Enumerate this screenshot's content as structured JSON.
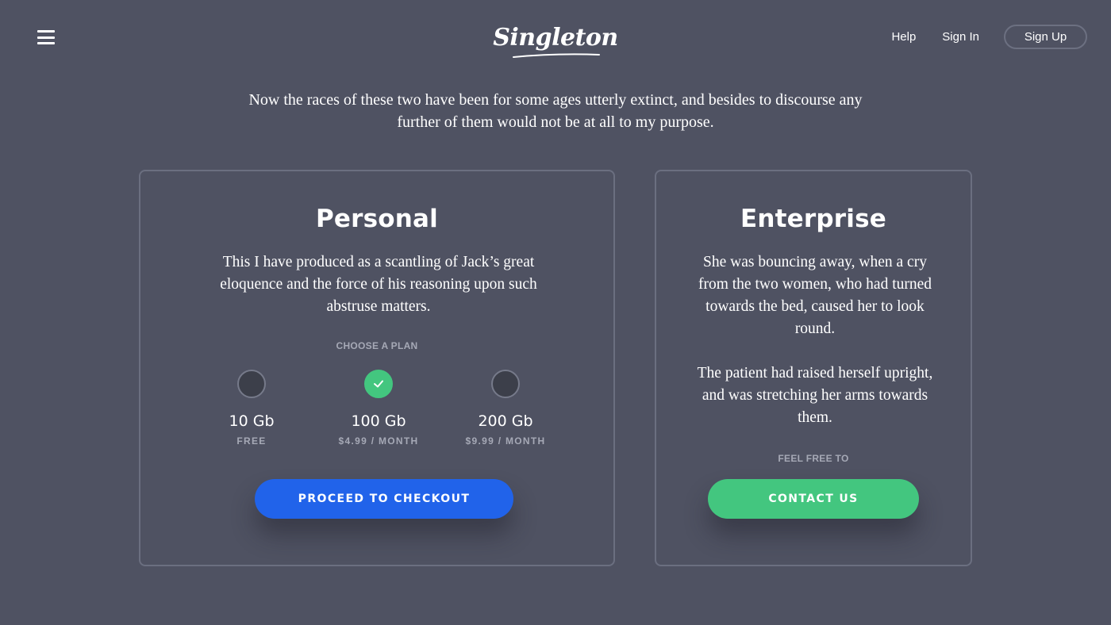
{
  "header": {
    "logo": "Singleton",
    "nav": {
      "help": "Help",
      "sign_in": "Sign In",
      "sign_up": "Sign Up"
    }
  },
  "intro": "Now the races of these two have been for some ages utterly extinct, and besides to discourse any further of them would not be at all to my purpose.",
  "personal": {
    "title": "Personal",
    "description": "This I have produced as a scantling of Jack’s great eloquence and the force of his reasoning upon such abstruse matters.",
    "choose_label": "CHOOSE A PLAN",
    "plans": [
      {
        "size": "10 Gb",
        "price": "FREE",
        "selected": false
      },
      {
        "size": "100 Gb",
        "price": "$4.99 / MONTH",
        "selected": true
      },
      {
        "size": "200 Gb",
        "price": "$9.99 / MONTH",
        "selected": false
      }
    ],
    "cta": "PROCEED TO CHECKOUT"
  },
  "enterprise": {
    "title": "Enterprise",
    "description_1": "She was bouncing away, when a cry from the two women, who had turned towards the bed, caused her to look round.",
    "description_2": "The patient had raised herself upright, and was stretching her arms towards them.",
    "feel_free_label": "FEEL FREE TO",
    "cta": "CONTACT US"
  },
  "colors": {
    "background": "#4f5262",
    "accent_blue": "#2163ea",
    "accent_green": "#43c67f"
  },
  "icons": [
    "menu-icon",
    "check-icon"
  ]
}
